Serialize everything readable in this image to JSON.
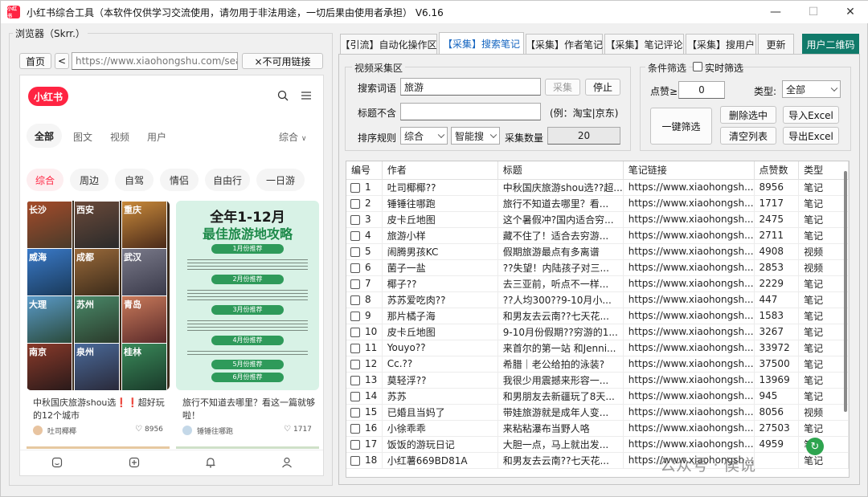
{
  "window": {
    "title": "小红书综合工具（本软件仅供学习交流使用，请勿用于非法用途，一切后果由使用者承担）  V6.16",
    "icon_label": "小红书",
    "controls": {
      "minimize": "—",
      "maximize": "☐",
      "close": "✕"
    }
  },
  "browser": {
    "group_title": "浏览器（Skrr.）",
    "home_button": "首页",
    "back_button": "<",
    "url": "https://www.xiaohongshu.com/search",
    "no_link_button": "×不可用链接",
    "app": {
      "logo": "小红书",
      "tabs": [
        "全部",
        "图文",
        "视频",
        "用户"
      ],
      "sort": "综合",
      "chips": [
        "综合",
        "周边",
        "自驾",
        "情侣",
        "自由行",
        "一日游"
      ],
      "card1": {
        "cities": [
          "长沙",
          "西安",
          "重庆",
          "威海",
          "成都",
          "武汉",
          "大理",
          "苏州",
          "青岛",
          "南京",
          "泉州",
          "桂林"
        ],
        "title": "中秋国庆旅游shou选❗️❗️超好玩的12个城市",
        "author": "吐司椰椰",
        "likes": "8956"
      },
      "card2": {
        "headline1": "全年1-12月",
        "headline2": "最佳旅游地攻略",
        "months": [
          "1月份推荐",
          "2月份推荐",
          "3月份推荐",
          "4月份推荐",
          "5月份推荐",
          "6月份推荐"
        ],
        "title": "旅行不知道去哪里？看这一篇就够啦！",
        "author": "锤锤往哪跑",
        "likes": "1717"
      }
    }
  },
  "tabs": [
    "【引流】自动化操作区",
    "【采集】搜索笔记",
    "【采集】作者笔记",
    "【采集】笔记评论",
    "【采集】搜用户",
    "更新",
    "用户二维码"
  ],
  "video_group": {
    "title": "视频采集区",
    "search_label": "搜索词语",
    "search_value": "旅游",
    "collect_button": "采集",
    "stop_button": "停止",
    "exclude_label": "标题不含",
    "exclude_value": "",
    "exclude_hint": "(例：淘宝|京东)",
    "sort_label": "排序规则",
    "sort_value": "综合",
    "smart_value": "智能搜",
    "count_label": "采集数量",
    "count_value": "20"
  },
  "filter_group": {
    "title": "条件筛选",
    "realtime_label": "实时筛选",
    "likes_label": "点赞≥",
    "likes_value": "0",
    "type_label": "类型:",
    "type_value": "全部",
    "one_click": "一键筛选",
    "delete_selected": "删除选中",
    "import_excel": "导入Excel",
    "clear_list": "清空列表",
    "export_excel": "导出Excel"
  },
  "table": {
    "headers": [
      "编号",
      "作者",
      "标题",
      "笔记链接",
      "点赞数",
      "类型"
    ],
    "rows": [
      [
        "1",
        "吐司椰椰??",
        "中秋国庆旅游shou选??超...",
        "https://www.xiaohongsh...",
        "8956",
        "笔记"
      ],
      [
        "2",
        "锤锤往哪跑",
        "旅行不知道去哪里？看...",
        "https://www.xiaohongsh...",
        "1717",
        "笔记"
      ],
      [
        "3",
        "皮卡丘地图",
        "这个暑假冲?国内适合穷...",
        "https://www.xiaohongsh...",
        "2475",
        "笔记"
      ],
      [
        "4",
        "旅游小样",
        "藏不住了！适合去穷游...",
        "https://www.xiaohongsh...",
        "2711",
        "笔记"
      ],
      [
        "5",
        "闹腾男孩KC",
        "假期旅游最点有多离谱",
        "https://www.xiaohongsh...",
        "4908",
        "视频"
      ],
      [
        "6",
        "菌子一盐",
        "??失望！内陆孩子对三...",
        "https://www.xiaohongsh...",
        "2853",
        "视频"
      ],
      [
        "7",
        "椰子??",
        "去三亚前，听点不一样...",
        "https://www.xiaohongsh...",
        "2229",
        "笔记"
      ],
      [
        "8",
        "苏苏爱吃肉??",
        "??人均300??9-10月小...",
        "https://www.xiaohongsh...",
        "447",
        "笔记"
      ],
      [
        "9",
        "那片橘子海",
        "和男友去云南??七天花...",
        "https://www.xiaohongsh...",
        "1583",
        "笔记"
      ],
      [
        "10",
        "皮卡丘地图",
        "9-10月份假期??穷游的1...",
        "https://www.xiaohongsh...",
        "3267",
        "笔记"
      ],
      [
        "11",
        "Youyo??",
        "来首尔的第一站 和Jenni...",
        "https://www.xiaohongsh...",
        "33972",
        "笔记"
      ],
      [
        "12",
        "Cc.??",
        "希腊｜老公给拍的泳装?",
        "https://www.xiaohongsh...",
        "37500",
        "笔记"
      ],
      [
        "13",
        "莫轻浮??",
        "我很少用震撼来形容一...",
        "https://www.xiaohongsh...",
        "13969",
        "笔记"
      ],
      [
        "14",
        "苏苏",
        "和男朋友去新疆玩了8天...",
        "https://www.xiaohongsh...",
        "945",
        "笔记"
      ],
      [
        "15",
        "已婚且当妈了",
        "带娃旅游就是成年人变...",
        "https://www.xiaohongsh...",
        "8056",
        "视频"
      ],
      [
        "16",
        "小徐乖乖",
        "来粘粘瀑布当野人咯",
        "https://www.xiaohongsh...",
        "27503",
        "笔记"
      ],
      [
        "17",
        "饭饭的游玩日记",
        "大胆一点，马上就出发...",
        "https://www.xiaohongsh...",
        "4959",
        "笔记"
      ],
      [
        "18",
        "小红薯669BD81A",
        "和男友去云南??七天花...",
        "https://www.xiaohongsh...",
        "",
        "笔记"
      ]
    ]
  },
  "watermark": "公众号 · 侯说"
}
